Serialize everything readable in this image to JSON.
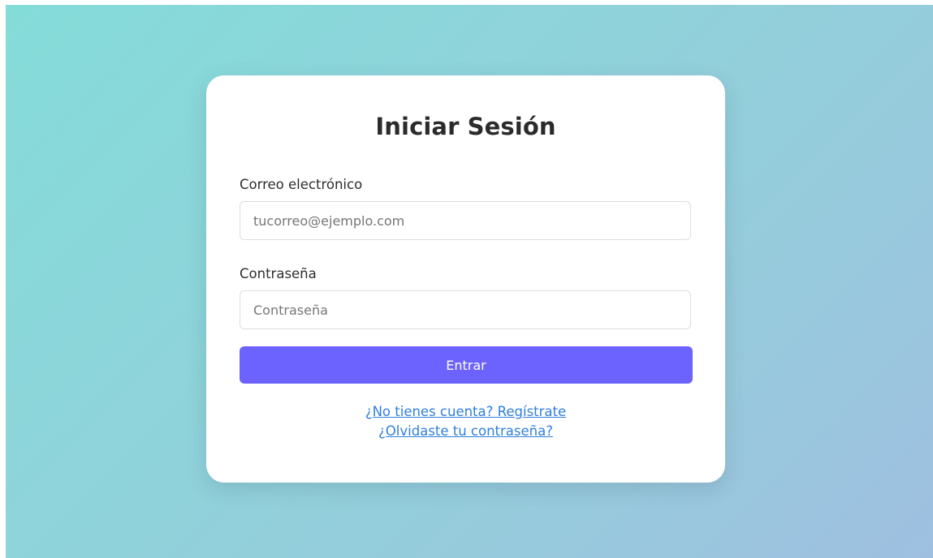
{
  "login": {
    "title": "Iniciar Sesión",
    "email": {
      "label": "Correo electrónico",
      "placeholder": "tucorreo@ejemplo.com",
      "value": ""
    },
    "password": {
      "label": "Contraseña",
      "placeholder": "Contraseña",
      "value": ""
    },
    "submit_label": "Entrar",
    "links": {
      "register": "¿No tienes cuenta? Regístrate",
      "forgot": "¿Olvidaste tu contraseña?"
    }
  },
  "colors": {
    "background_gradient": [
      "#84dcd9",
      "#9fbfe1"
    ],
    "button": "#6c63ff",
    "link": "#2f7fdc"
  }
}
